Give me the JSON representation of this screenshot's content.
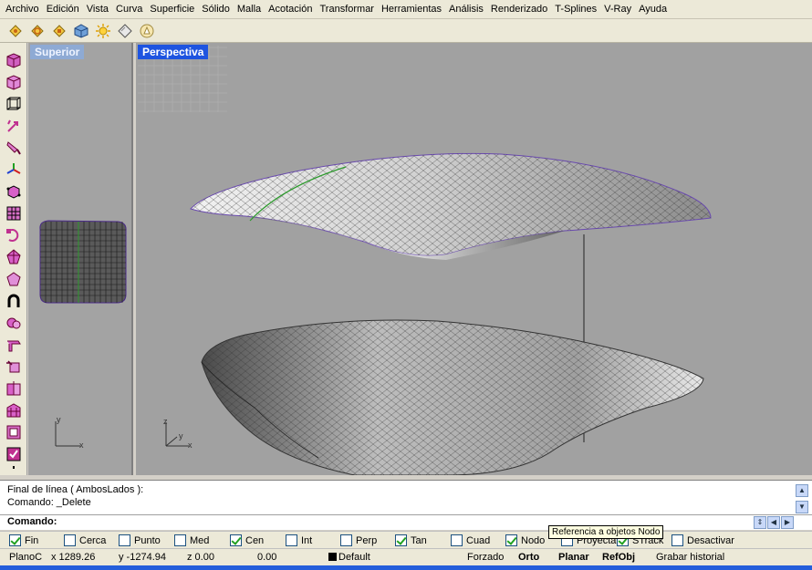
{
  "menu": [
    "Archivo",
    "Edición",
    "Vista",
    "Curva",
    "Superficie",
    "Sólido",
    "Malla",
    "Acotación",
    "Transformar",
    "Herramientas",
    "Análisis",
    "Renderizado",
    "T-Splines",
    "V-Ray",
    "Ayuda"
  ],
  "toolbar_icons": [
    "render-icon",
    "render-preview-icon",
    "render-settings-icon",
    "shaded-box-icon",
    "light-icon",
    "material-icon",
    "camera-icon"
  ],
  "left_tool_icons": [
    "box-select-icon",
    "shaded-cube-icon",
    "wire-cube-icon",
    "arrows-icon",
    "brush-icon",
    "axes-icon",
    "gumball-box-icon",
    "box-grid-icon",
    "rotate-icon",
    "gem-icon",
    "polygon-icon",
    "magnet-icon",
    "spheres-icon",
    "fold-icon",
    "crease-icon",
    "weld-icon",
    "wall-icon",
    "frame-icon",
    "check-face-icon",
    "joint-icon"
  ],
  "viewports": {
    "top": {
      "title": "Superior",
      "axis_y": "y",
      "axis_x": "x"
    },
    "perspective": {
      "title": "Perspectiva",
      "axis_z": "z",
      "axis_y": "y",
      "axis_x": "x"
    }
  },
  "command_history": [
    "Final de línea ( AmbosLados ):",
    "Comando: _Delete"
  ],
  "command_prompt": "Comando:",
  "osnaps": [
    {
      "label": "Fin",
      "checked": true
    },
    {
      "label": "Cerca",
      "checked": false
    },
    {
      "label": "Punto",
      "checked": false
    },
    {
      "label": "Med",
      "checked": false
    },
    {
      "label": "Cen",
      "checked": true
    },
    {
      "label": "Int",
      "checked": false
    },
    {
      "label": "Perp",
      "checked": false
    },
    {
      "label": "Tan",
      "checked": true
    },
    {
      "label": "Cuad",
      "checked": false
    },
    {
      "label": "Nodo",
      "checked": true
    },
    {
      "label": "Proyectar",
      "checked": false
    },
    {
      "label": "STrack",
      "checked": true
    },
    {
      "label": "Desactivar",
      "checked": false
    }
  ],
  "tooltip": "Referencia a objetos Nodo",
  "status": {
    "plane": "PlanoC",
    "x": "x 1289.26",
    "y": "y -1274.94",
    "z": "z 0.00",
    "distance": "0.00",
    "layer": "Default",
    "forced": "Forzado",
    "ortho": "Orto",
    "planar": "Planar",
    "refobj": "RefObj",
    "history": "Grabar historial"
  },
  "colors": {
    "viewport_bg": "#a1a1a1",
    "active_title": "#1e54e0",
    "inactive_title": "#8eaad4",
    "chrome": "#ece9d8"
  }
}
